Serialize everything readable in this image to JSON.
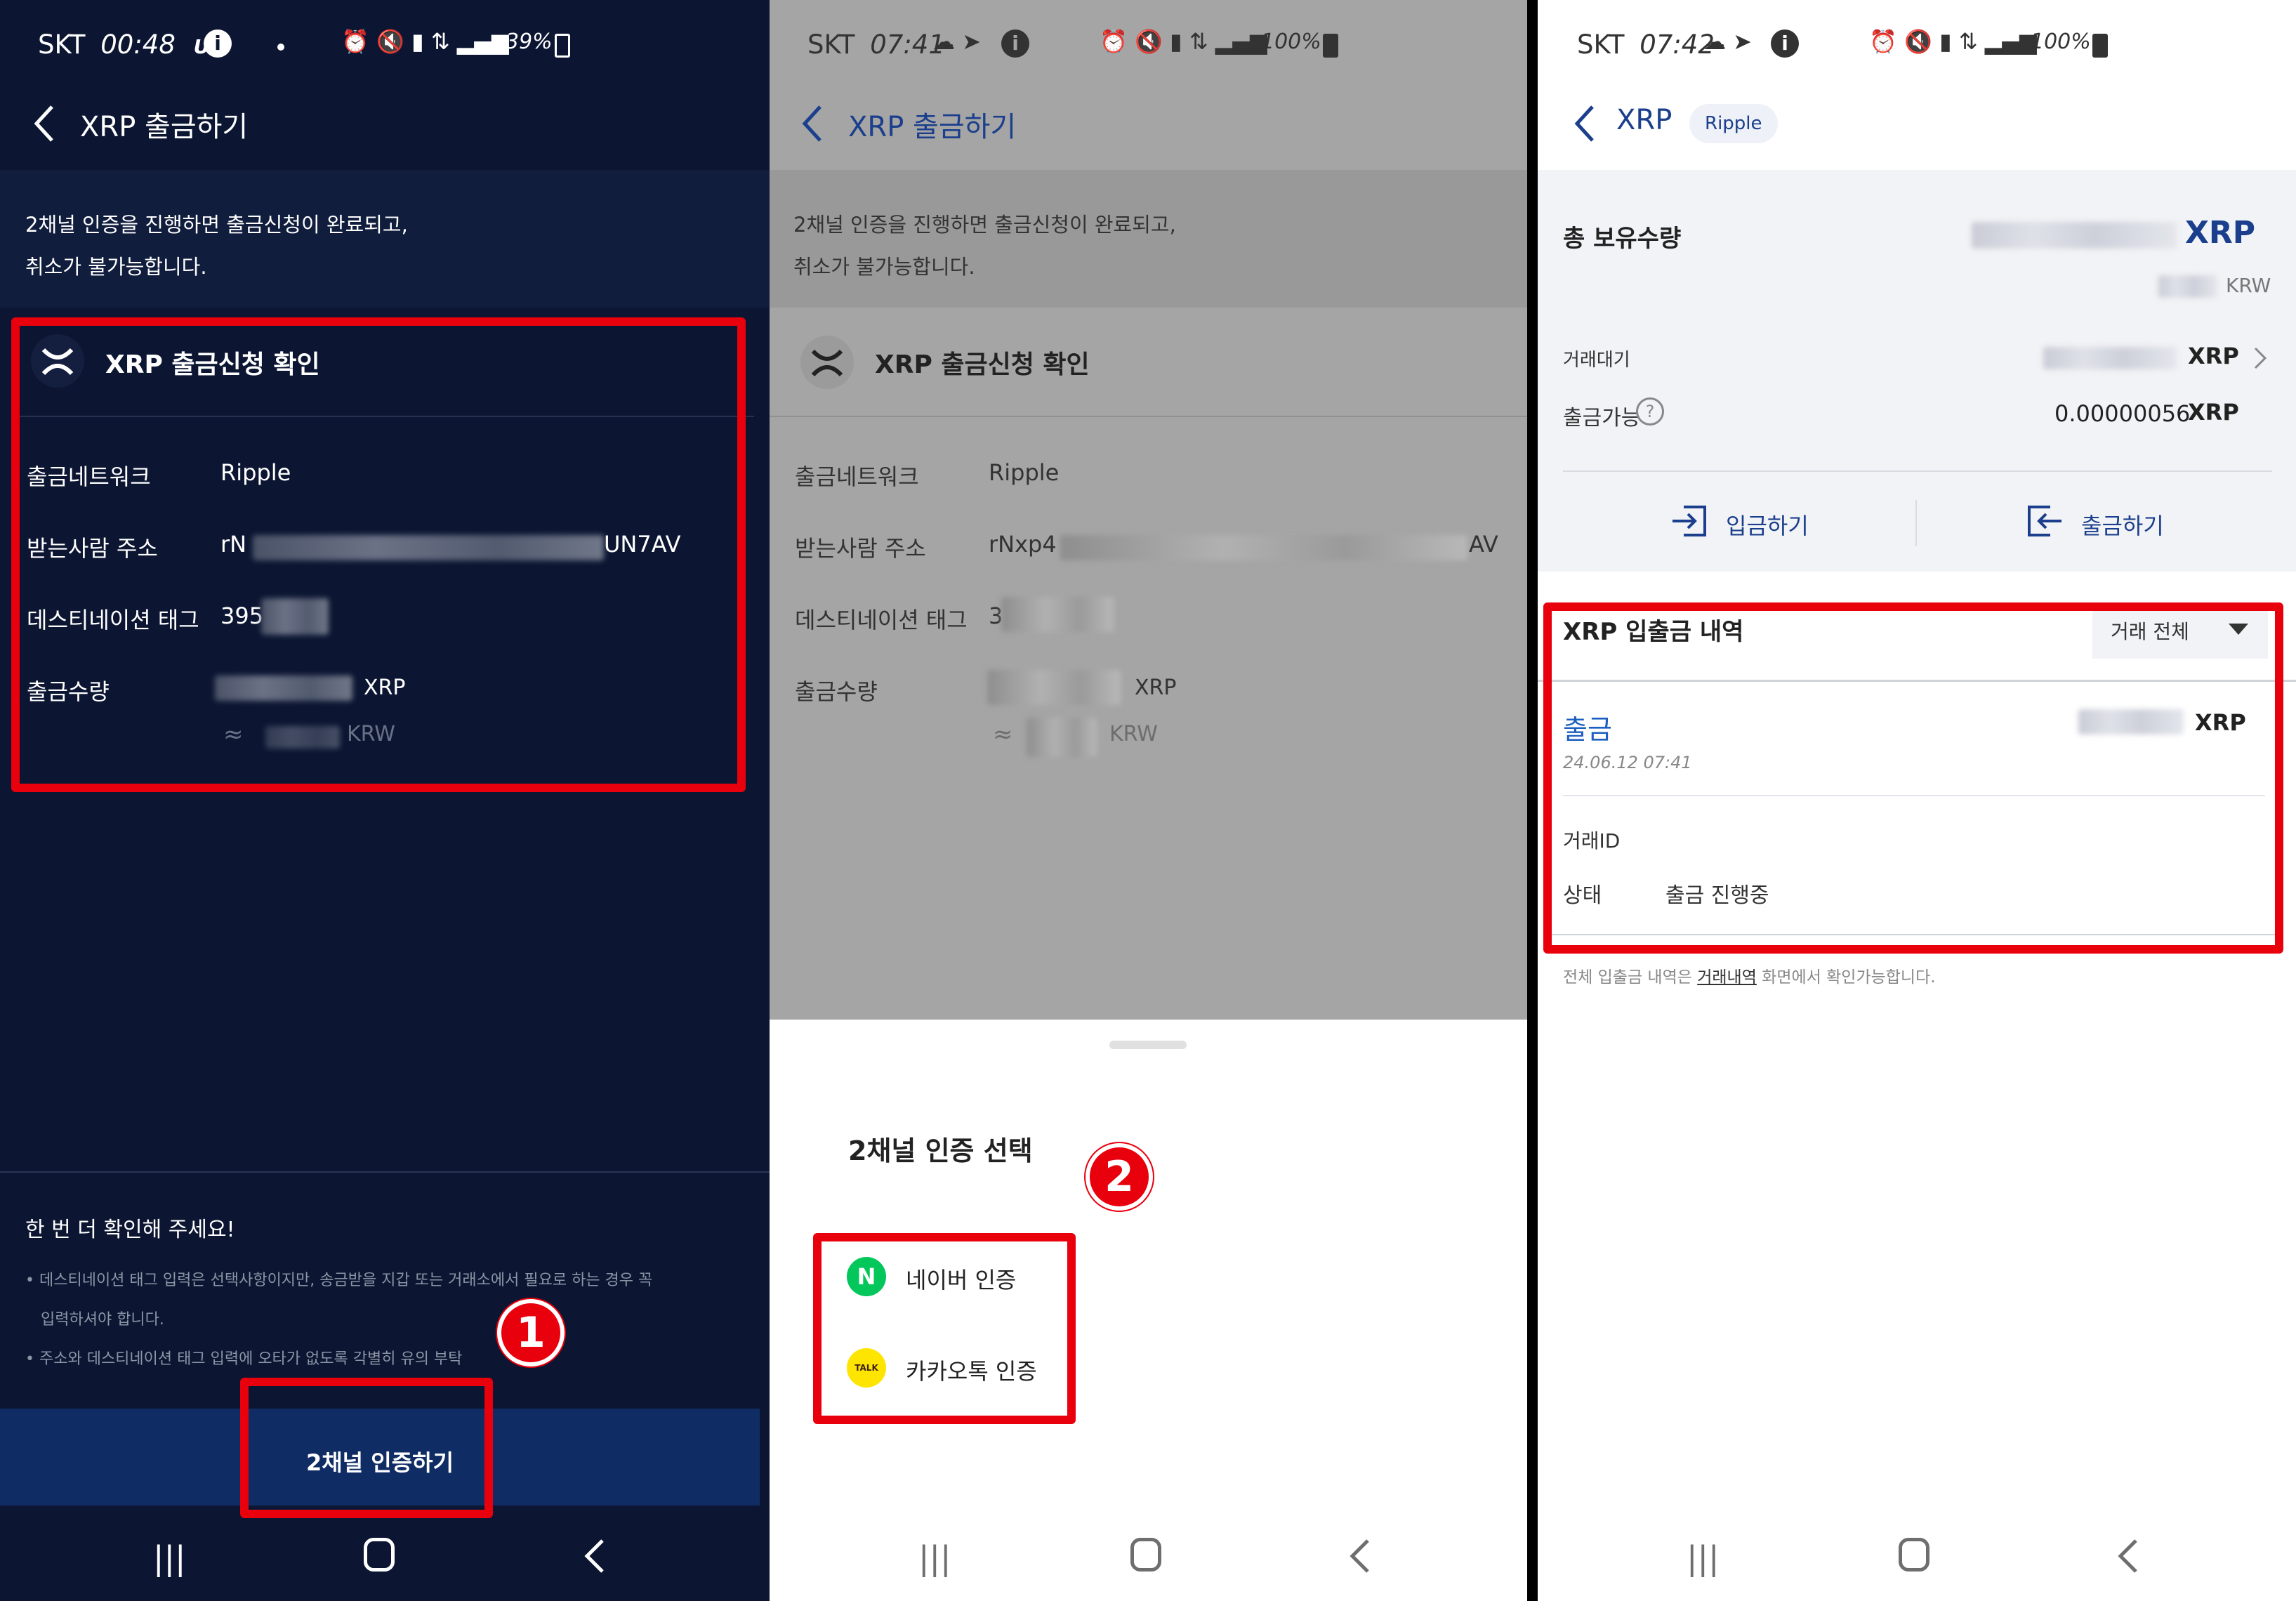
{
  "colors": {
    "dark_bg": "#0c1632",
    "dark_button": "#0f2c64",
    "brand_blue": "#1b3f8c",
    "highlight_red": "#e8000c",
    "naver_green": "#03c75a",
    "kakao_yellow": "#fee500"
  },
  "panel1": {
    "status": {
      "carrier": "SKT",
      "time": "00:48",
      "extra": "UP",
      "battery": "39%"
    },
    "header": {
      "back_icon": "chevron-left-icon",
      "title": "XRP 출금하기"
    },
    "notice": {
      "line1": "2채널 인증을 진행하면 출금신청이 완료되고,",
      "line2": "취소가 불가능합니다."
    },
    "confirm": {
      "title": "XRP 출금신청 확인",
      "rows": [
        {
          "label": "출금네트워크",
          "value": "Ripple"
        },
        {
          "label": "받는사람 주소",
          "value_prefix": "rN",
          "value_suffix": "UN7AV"
        },
        {
          "label": "데스티네이션 태그",
          "value_prefix": "395"
        },
        {
          "label": "출금수량",
          "value_suffix": "XRP"
        }
      ],
      "approx_symbol": "≈",
      "approx_unit": "KRW"
    },
    "warning": {
      "title": "한 번 더 확인해 주세요!",
      "items": [
        "데스티네이션 태그 입력은 선택사항이지만, 송금받을 지갑 또는 거래소에서 필요로 하는 경우 꼭",
        "입력하셔야 합니다.",
        "주소와 데스티네이션 태그 입력에 오타가 없도록 각별히 유의 부탁"
      ]
    },
    "button": {
      "label": "2채널 인증하기"
    },
    "marker": "1"
  },
  "panel2": {
    "status": {
      "carrier": "SKT",
      "time": "07:41",
      "battery": "100%"
    },
    "header": {
      "title": "XRP 출금하기"
    },
    "notice": {
      "line1": "2채널 인증을 진행하면 출금신청이 완료되고,",
      "line2": "취소가 불가능합니다."
    },
    "confirm": {
      "title": "XRP 출금신청 확인",
      "rows": [
        {
          "label": "출금네트워크",
          "value": "Ripple"
        },
        {
          "label": "받는사람 주소",
          "value_prefix": "rNxp4",
          "value_suffix": "AV"
        },
        {
          "label": "데스티네이션 태그",
          "value_prefix": "3"
        },
        {
          "label": "출금수량",
          "value_suffix": "XRP"
        }
      ],
      "approx_symbol": "≈",
      "approx_unit": "KRW"
    },
    "sheet": {
      "title": "2채널 인증 선택",
      "options": [
        {
          "icon": "naver-n-icon",
          "label": "네이버 인증",
          "glyph": "N"
        },
        {
          "icon": "kakaotalk-icon",
          "label": "카카오톡 인증",
          "glyph": "TALK"
        }
      ]
    },
    "marker": "2"
  },
  "panel3": {
    "status": {
      "carrier": "SKT",
      "time": "07:42",
      "battery": "100%"
    },
    "header": {
      "title": "XRP",
      "network_badge": "Ripple"
    },
    "holdings": {
      "label": "총 보유수량",
      "unit": "XRP",
      "krw_unit": "KRW",
      "pending_label": "거래대기",
      "pending_unit": "XRP",
      "available_label": "출금가능",
      "available_value": "0.00000056",
      "available_unit": "XRP"
    },
    "actions": {
      "deposit": "입금하기",
      "withdraw": "출금하기"
    },
    "history": {
      "title": "XRP 입출금 내역",
      "filter": "거래 전체",
      "entry": {
        "type": "출금",
        "amount_unit": "XRP",
        "datetime": "24.06.12 07:41",
        "txid_label": "거래ID",
        "status_label": "상태",
        "status_value": "출금 진행중"
      },
      "footer_pre": "전체 입출금 내역은",
      "footer_link": "거래내역",
      "footer_post": "화면에서 확인가능합니다."
    }
  }
}
